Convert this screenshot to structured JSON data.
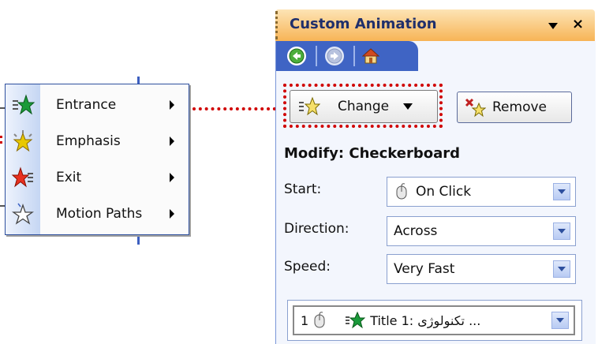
{
  "menu": {
    "items": [
      {
        "label": "Entrance",
        "icon": "entrance-star-icon",
        "color": "#1a9a3a"
      },
      {
        "label": "Emphasis",
        "icon": "emphasis-star-icon",
        "color": "#e8c800"
      },
      {
        "label": "Exit",
        "icon": "exit-star-icon",
        "color": "#e83020"
      },
      {
        "label": "Motion Paths",
        "icon": "motion-path-star-icon",
        "color": "#ffffff"
      }
    ]
  },
  "pane": {
    "title": "Custom Animation",
    "close_glyph": "×",
    "change_label": "Change",
    "remove_label": "Remove",
    "modify_heading": "Modify: Checkerboard",
    "fields": {
      "start_label": "Start:",
      "start_value": "On Click",
      "direction_label": "Direction:",
      "direction_value": "Across",
      "speed_label": "Speed:",
      "speed_value": "Very Fast"
    },
    "list": {
      "order": "1",
      "text": "Title 1: تکنولوژی ..."
    }
  },
  "colors": {
    "accent": "#3f64c4",
    "title_bar": "#f7b456",
    "highlight": "#d00000"
  }
}
